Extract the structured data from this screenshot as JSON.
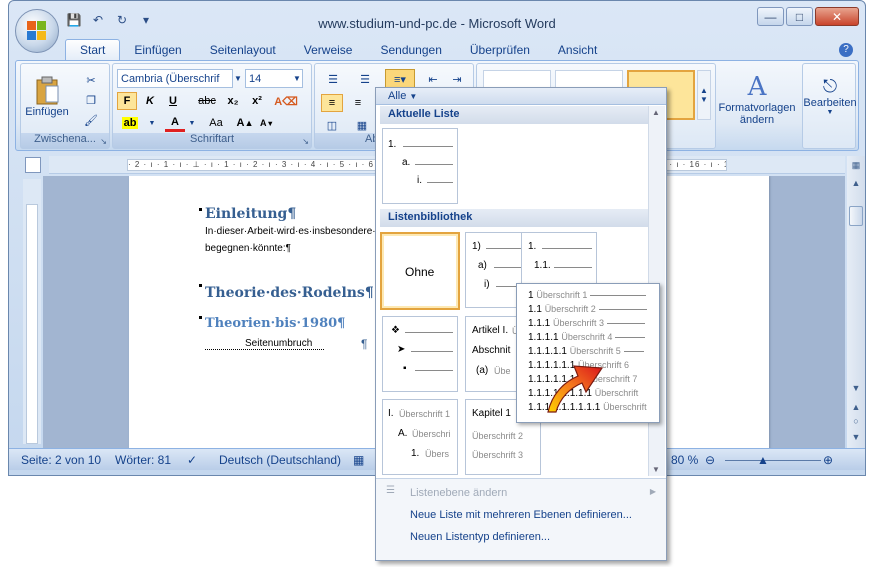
{
  "window": {
    "title": "www.studium-und-pc.de - Microsoft Word",
    "controls": [
      "minimize",
      "maximize",
      "close"
    ]
  },
  "qat": {
    "icons": [
      "save-icon",
      "undo-icon",
      "redo-icon",
      "customize-qat-icon"
    ]
  },
  "tabs": [
    "Start",
    "Einfügen",
    "Seitenlayout",
    "Verweise",
    "Sendungen",
    "Überprüfen",
    "Ansicht"
  ],
  "active_tab": "Start",
  "ribbon": {
    "clipboard": {
      "paste_label": "Einfügen",
      "group_label": "Zwischena..."
    },
    "font": {
      "font_name": "Cambria (Überschrif",
      "font_size": "14",
      "group_label": "Schriftart",
      "bold": "F",
      "italic": "K",
      "underline": "U",
      "strike": "abc",
      "subscript": "x₂",
      "superscript": "x²",
      "grow": "A",
      "shrink": "A"
    },
    "paragraph": {
      "group_label": "Absa"
    },
    "styles": {
      "change_label_1": "Formatvorlagen",
      "change_label_2": "ändern"
    },
    "editing": {
      "label": "Bearbeiten"
    }
  },
  "ruler": {
    "text": "· 2 · ı · 1 · ı · ⊥ · ı · 1 · ı · 2 · ı · 3 · ı · 4 · ı · 5 · ı · 6 · ı · 7 · ı · 8 · ı · 9 · ı · 10 · ı · 11 · ı · 12 · ı · 13 · ı · 14 · ı · 15 · ı · 16 · ı · 17 · ı · 18 ·"
  },
  "document": {
    "h1": "Einleitung¶",
    "p1": "In·dieser·Arbeit·wird·es·insbesondere·",
    "p2": "begegnen·könnte:¶",
    "h2": "Theorie·des·Rodelns¶",
    "h3": "Theorien·bis·1980¶",
    "page_break": "Seitenumbruch",
    "page_break_mark": "¶"
  },
  "statusbar": {
    "page": "Seite: 2 von 10",
    "words": "Wörter: 81",
    "language": "Deutsch (Deutschland)",
    "zoom": "80 %"
  },
  "dropdown": {
    "filter": "Alle",
    "section_current": "Aktuelle Liste",
    "section_library": "Listenbibliothek",
    "current": {
      "l1": "1.",
      "l2": "a.",
      "l3": "i."
    },
    "tile_none": "Ohne",
    "tile2": {
      "l1": "1)",
      "l2": "a)",
      "l3": "i)"
    },
    "tile3": {
      "l1": "1.",
      "l2": "1.1."
    },
    "tile5": {
      "l1": "Artikel I.",
      "l1g": "Ü",
      "l2": "Abschnit",
      "l3": "(a)",
      "l3g": "Übe"
    },
    "tile6": {
      "l1": "I.",
      "l1g": "Überschrift 1",
      "l2": "A.",
      "l2g": "Überschri",
      "l3": "1.",
      "l3g": "Übers"
    },
    "tile7": {
      "l1": "Kapitel 1",
      "l2g": "Überschrift 2",
      "l3g": "Überschrift 3"
    },
    "menu_change_level": "Listenebene ändern",
    "menu_define_multilevel": "Neue Liste mit mehreren Ebenen definieren...",
    "menu_define_style": "Neuen Listentyp definieren..."
  },
  "preview": {
    "rows": [
      {
        "num": "1",
        "txt": "Überschrift 1"
      },
      {
        "num": "1.1",
        "txt": "Überschrift 2"
      },
      {
        "num": "1.1.1",
        "txt": "Überschrift 3"
      },
      {
        "num": "1.1.1.1",
        "txt": "Überschrift 4"
      },
      {
        "num": "1.1.1.1.1",
        "txt": "Überschrift 5"
      },
      {
        "num": "1.1.1.1.1.1",
        "txt": "Überschrift 6"
      },
      {
        "num": "1.1.1.1.1.1.1",
        "txt": "Überschrift 7"
      },
      {
        "num": "1.1.1.1.1.1.1.1",
        "txt": "Überschrift"
      },
      {
        "num": "1.1.1.1.1.1.1.1.1",
        "txt": "Überschrift"
      }
    ]
  },
  "colors": {
    "accent": "#15428b",
    "heading": "#365f91",
    "selection": "#e3a43f",
    "arrow": "#e8301c"
  }
}
